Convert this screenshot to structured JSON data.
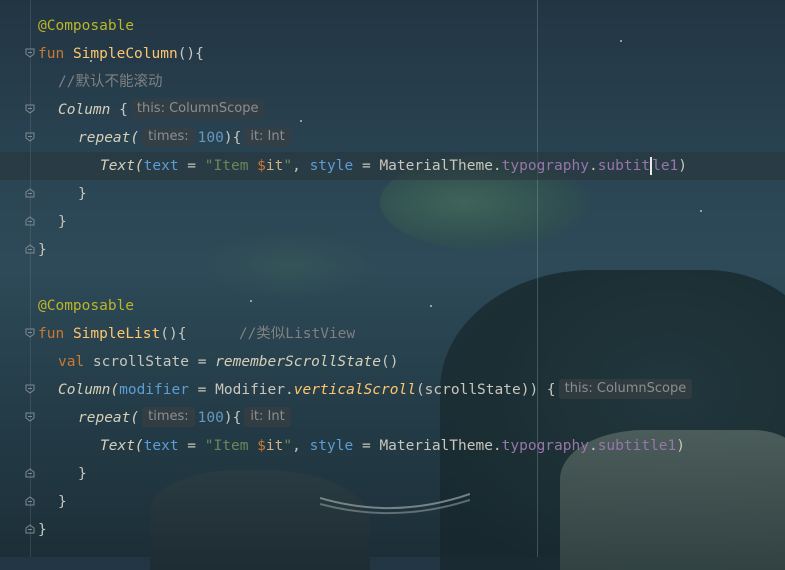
{
  "editor": {
    "block1": {
      "annotation": "@Composable",
      "fun_kw": "fun",
      "fun_name": "SimpleColumn",
      "fun_suffix": "(){",
      "comment": "//默认不能滚动",
      "column_call": "Column",
      "column_brace": " {",
      "column_hint": "this: ColumnScope",
      "repeat_call": "repeat(",
      "repeat_hint": "times:",
      "repeat_count": "100",
      "repeat_close": "){",
      "it_hint": "it: Int",
      "text_call": "Text(",
      "text_param": "text",
      "eq1": " = ",
      "str_open": "\"Item ",
      "dollar": "$",
      "it_ref": "it",
      "str_close": "\"",
      "comma": ", ",
      "style_param": "style",
      "eq2": " = ",
      "theme": "MaterialTheme.",
      "typography": "typography",
      "dot": ".",
      "subtitle_a": "subtit",
      "subtitle_b": "le1",
      "close_paren": ")",
      "close_brace_inner": "}",
      "close_brace_mid": "}",
      "close_brace_outer": "}"
    },
    "block2": {
      "annotation": "@Composable",
      "fun_kw": "fun",
      "fun_name": "SimpleList",
      "fun_suffix": "(){",
      "comment": "//类似ListView",
      "val_kw": "val",
      "scroll_var": " scrollState = ",
      "remember_call": "rememberScrollState",
      "remember_parens": "()",
      "column_call": "Column(",
      "modifier_param": "modifier",
      "eq": " = ",
      "modifier_obj": "Modifier.",
      "vertical_scroll": "verticalScroll",
      "vs_args": "(scrollState)) {",
      "column_hint": "this: ColumnScope",
      "repeat_call": "repeat(",
      "repeat_hint": "times:",
      "repeat_count": "100",
      "repeat_close": "){",
      "it_hint": "it: Int",
      "text_call": "Text(",
      "text_param": "text",
      "eq1": " = ",
      "str_open": "\"Item ",
      "dollar": "$",
      "it_ref": "it",
      "str_close": "\"",
      "comma": ", ",
      "style_param": "style",
      "eq2": " = ",
      "theme": "MaterialTheme.",
      "typography": "typography",
      "dot": ".",
      "subtitle": "subtitle1",
      "close_paren": ")",
      "close_brace_inner": "}",
      "close_brace_mid": "}",
      "close_brace_outer": "}"
    }
  },
  "colors": {
    "annotation": "#bbb529",
    "keyword": "#cc7832",
    "function": "#ffc66d",
    "string": "#6a8759",
    "number": "#6897bb",
    "property": "#9876aa",
    "named_param": "#5c9dd6",
    "comment": "#808080"
  }
}
